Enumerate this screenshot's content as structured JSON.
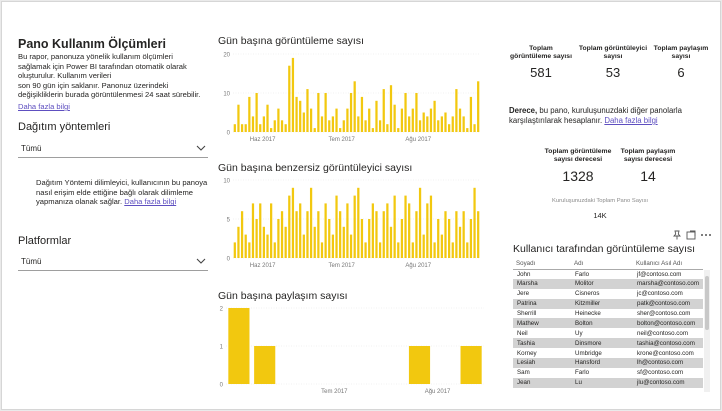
{
  "header": {
    "title": "Pano Kullanım Ölçümleri",
    "description_lines": [
      "Bu rapor, panonuza yönelik kullanım ölçümleri",
      "sağlamak için Power BI tarafından otomatik olarak",
      "oluşturulur. Kullanım verileri",
      "son 90 gün için saklanır. Panonuz üzerindeki",
      "değişikliklerin burada görüntülenmesi 24 saat sürebilir."
    ],
    "learn_more": "Daha fazla bilgi"
  },
  "filters": {
    "distribution": {
      "title": "Dağıtım yöntemleri",
      "value": "Tümü"
    },
    "slicer_note_lines": [
      "Dağıtım Yöntemi dilimleyici, kullanıcının bu panoya",
      "nasıl erişim elde ettiğine bağlı olarak dilimleme",
      "yapmanıza olanak sağlar."
    ],
    "slicer_note_link": "Daha fazla bilgi",
    "platform": {
      "title": "Platformlar",
      "value": "Tümü"
    }
  },
  "kpis": {
    "total_views_label": "Toplam görüntüleme sayısı",
    "total_views_value": "581",
    "total_viewers_label": "Toplam görüntüleyici sayısı",
    "total_viewers_value": "53",
    "total_shares_label": "Toplam paylaşım sayısı",
    "total_shares_value": "6"
  },
  "rank_note": {
    "bold": "Derece,",
    "text_line1": " bu pano, kuruluşunuzdaki diğer panolarla",
    "text_line2": "karşılaştırılarak hesaplanır.",
    "link": "Daha fazla bilgi"
  },
  "ranks": {
    "views_rank_label": "Toplam görüntüleme sayısı derecesi",
    "views_rank_value": "1328",
    "shares_rank_label": "Toplam paylaşım sayısı derecesi",
    "shares_rank_value": "14",
    "org_total_label": "Kuruluşunuzdaki Toplam Pano Sayısı",
    "org_total_value": "14K"
  },
  "colors": {
    "bar": "#F2C80F",
    "link": "#5E4FC0",
    "row_alt": "#D2D2D2"
  },
  "chart_data": [
    {
      "type": "bar",
      "title": "Gün başına görüntüleme sayısı",
      "ylim": [
        0,
        20
      ],
      "yticks": [
        "20",
        "10",
        "0"
      ],
      "xticks": [
        "Haz 2017",
        "Tem 2017",
        "Ağu 2017"
      ],
      "values": [
        2,
        7,
        2,
        2,
        9,
        4,
        10,
        2,
        4,
        7,
        1,
        3,
        6,
        3,
        2,
        17,
        19,
        9,
        8,
        5,
        11,
        6,
        1,
        10,
        4,
        10,
        3,
        4,
        6,
        1,
        3,
        6,
        10,
        13,
        4,
        9,
        3,
        6,
        1,
        8,
        3,
        11,
        2,
        12,
        7,
        1,
        6,
        10,
        4,
        6,
        10,
        3,
        5,
        4,
        6,
        8,
        3,
        4,
        5,
        2,
        4,
        11,
        6,
        4,
        1,
        9,
        2,
        13
      ]
    },
    {
      "type": "bar",
      "title": "Gün başına benzersiz görüntüleyici sayısı",
      "ylim": [
        0,
        10
      ],
      "yticks": [
        "10",
        "5",
        "0"
      ],
      "xticks": [
        "Haz 2017",
        "Tem 2017",
        "Ağu 2017"
      ],
      "values": [
        2,
        4,
        6,
        3,
        2,
        7,
        5,
        7,
        4,
        3,
        7,
        2,
        5,
        6,
        4,
        8,
        9,
        6,
        7,
        3,
        6,
        9,
        4,
        6,
        2,
        7,
        5,
        3,
        8,
        6,
        4,
        7,
        3,
        8,
        9,
        5,
        2,
        5,
        7,
        6,
        2,
        6,
        7,
        4,
        8,
        2,
        5,
        8,
        7,
        2,
        6,
        9,
        3,
        7,
        8,
        2,
        5,
        3,
        6,
        5,
        2,
        6,
        4,
        6,
        2,
        5,
        9,
        6
      ]
    },
    {
      "type": "bar",
      "title": "Gün başına paylaşım sayısı",
      "ylim": [
        0,
        2
      ],
      "yticks": [
        "2",
        "1",
        "0"
      ],
      "xticks": [
        "Tem 2017",
        "Ağu 2017"
      ],
      "values": [
        2,
        1,
        0,
        0,
        0,
        0,
        0,
        1,
        0,
        1
      ]
    }
  ],
  "table": {
    "title": "Kullanıcı tarafından görüntüleme sayısı",
    "columns": [
      "Soyadı",
      "Adı",
      "Kullanıcı Asıl Adı"
    ],
    "rows": [
      [
        "John",
        "Farlo",
        "jf@contoso.com"
      ],
      [
        "Marsha",
        "Molitor",
        "marsha@contoso.com"
      ],
      [
        "Jere",
        "Cisneros",
        "jc@contoso.com"
      ],
      [
        "Patrina",
        "Kitzmiller",
        "patk@contoso.com"
      ],
      [
        "Sherrill",
        "Heinecke",
        "sher@contoso.com"
      ],
      [
        "Mathew",
        "Bolton",
        "bolton@contoso.com"
      ],
      [
        "Neil",
        "Uy",
        "neil@contoso.com"
      ],
      [
        "Tashia",
        "Dinsmore",
        "tashia@contoso.com"
      ],
      [
        "Korney",
        "Umbridge",
        "krone@contoso.com"
      ],
      [
        "Lesiah",
        "Hansford",
        "lh@contoso.com"
      ],
      [
        "Sam",
        "Farlo",
        "sf@contoso.com"
      ],
      [
        "Jean",
        "Lu",
        "jlu@contoso.com"
      ]
    ]
  }
}
